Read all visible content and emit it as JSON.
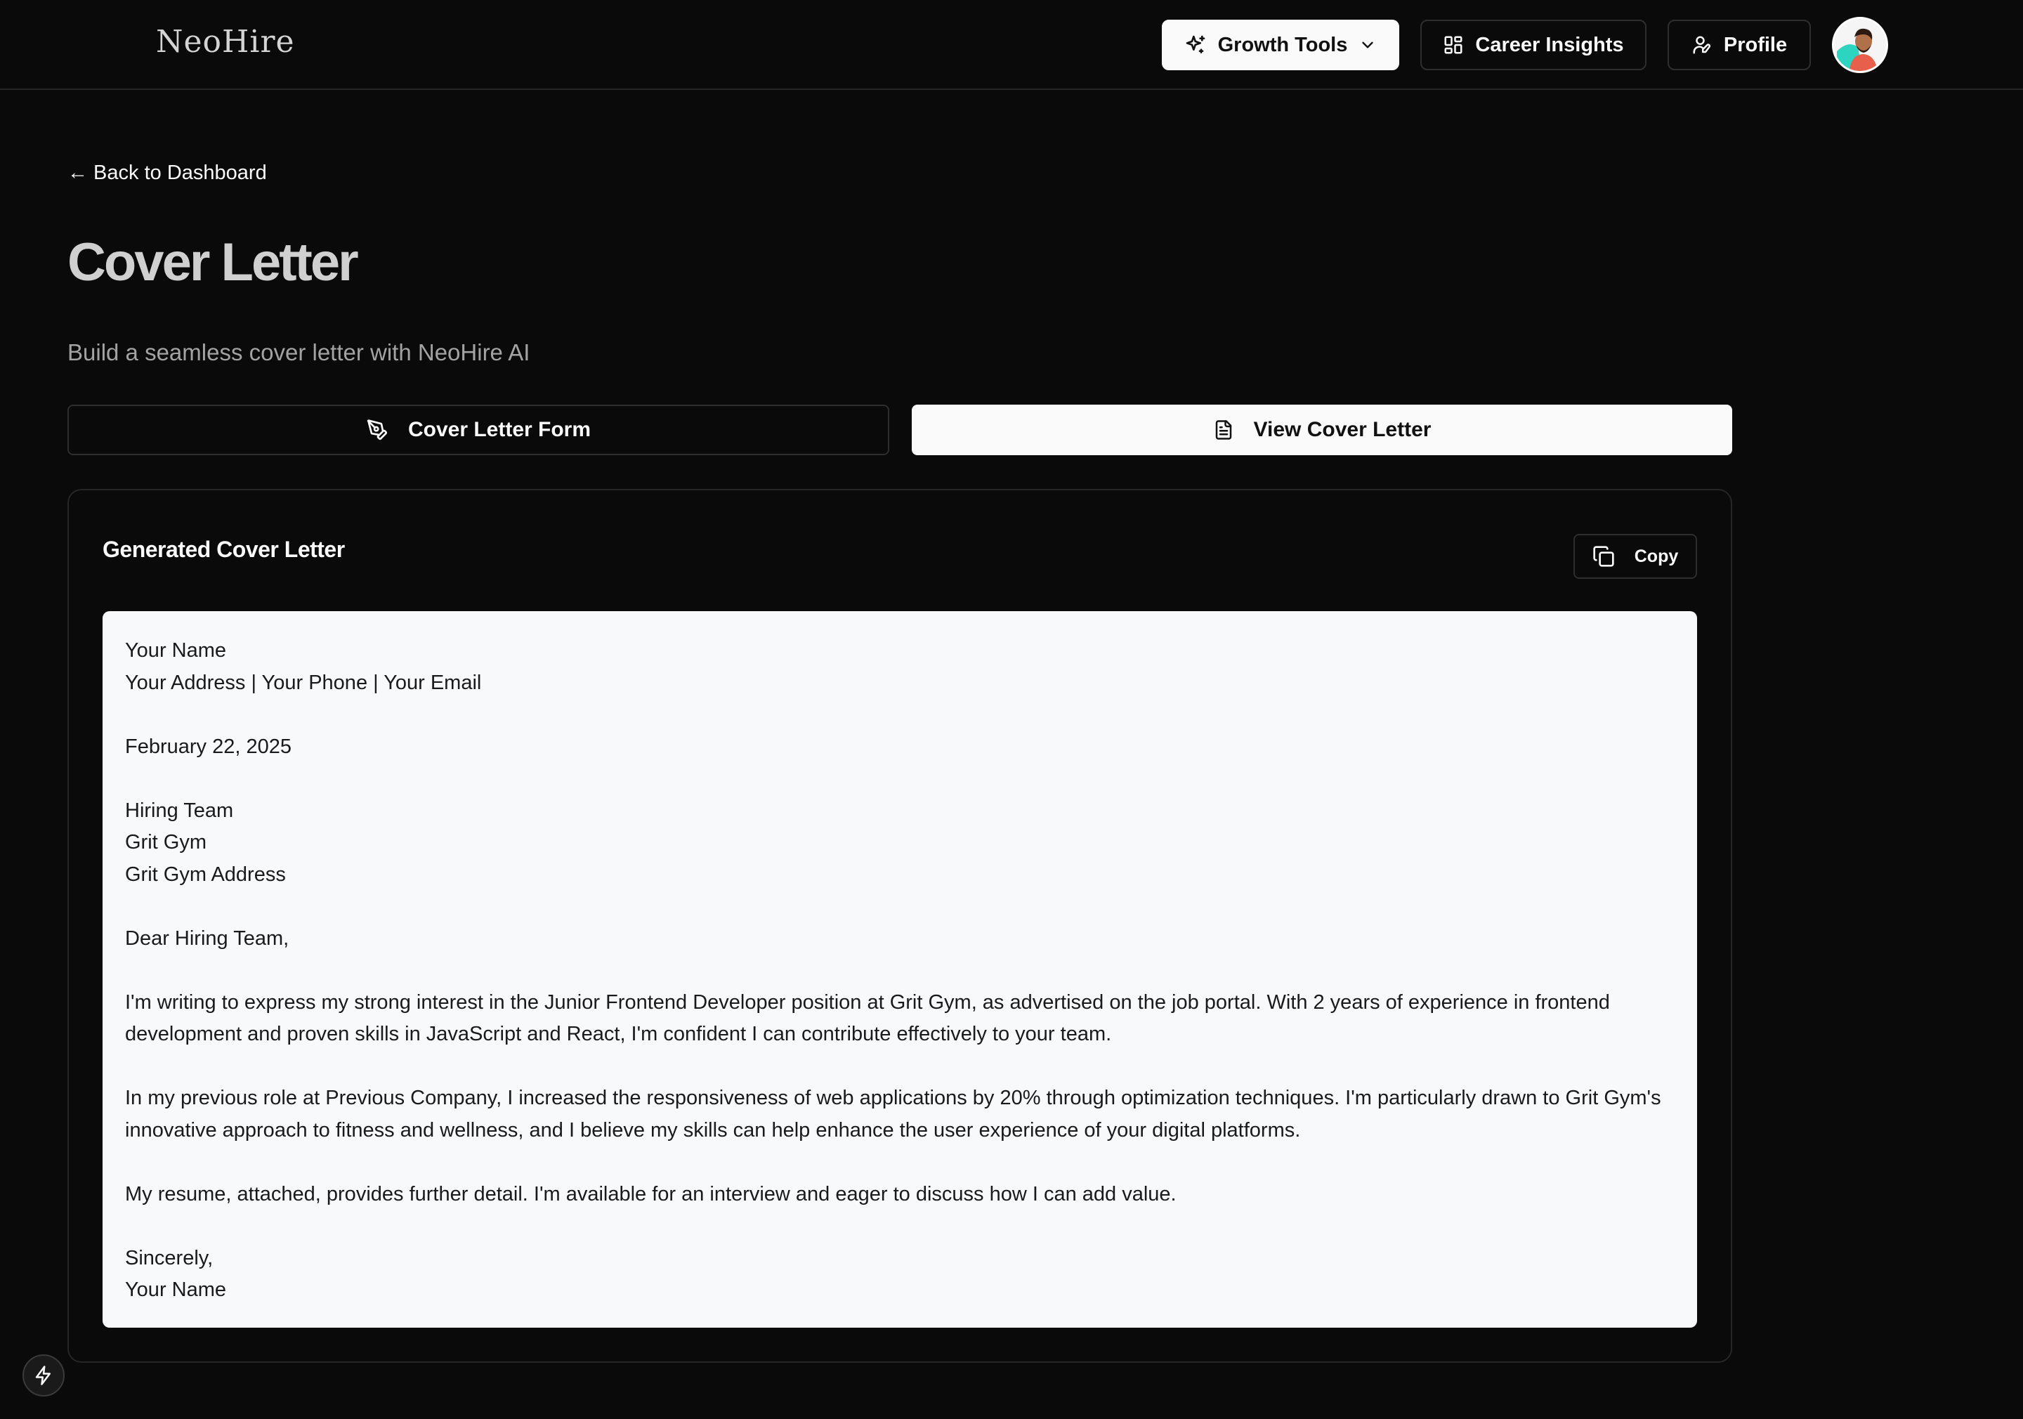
{
  "app": {
    "logo": "NeoHire"
  },
  "nav": {
    "growth_tools": "Growth Tools",
    "career_insights": "Career Insights",
    "profile": "Profile"
  },
  "page": {
    "back_link": "← Back to Dashboard",
    "title": "Cover Letter",
    "subtitle": "Build a seamless cover letter with NeoHire AI"
  },
  "tabs": {
    "form": "Cover Letter Form",
    "view": "View Cover Letter",
    "active": "view"
  },
  "card": {
    "title": "Generated Cover Letter",
    "copy_label": "Copy"
  },
  "letter": {
    "name": "Your Name",
    "contact": "Your Address | Your Phone | Your Email",
    "date": "February 22, 2025",
    "recipient": "Hiring Team",
    "company": "Grit Gym",
    "company_address": "Grit Gym Address",
    "salutation": "Dear Hiring Team,",
    "paragraph1": "I'm writing to express my strong interest in the Junior Frontend Developer position at Grit Gym, as advertised on the job portal. With 2 years of experience in frontend development and proven skills in JavaScript and React, I'm confident I can contribute effectively to your team.",
    "paragraph2": "In my previous role at Previous Company, I increased the responsiveness of web applications by 20% through optimization techniques. I'm particularly drawn to Grit Gym's innovative approach to fitness and wellness, and I believe my skills can help enhance the user experience of your digital platforms.",
    "paragraph3": "My resume, attached, provides further detail. I'm available for an interview and eager to discuss how I can add value.",
    "closing": "Sincerely,",
    "signature": "Your Name"
  },
  "colors": {
    "background": "#0a0a0a",
    "accent_light": "#fafafa",
    "border": "#262626",
    "letter_bg": "#f8f9fb"
  }
}
